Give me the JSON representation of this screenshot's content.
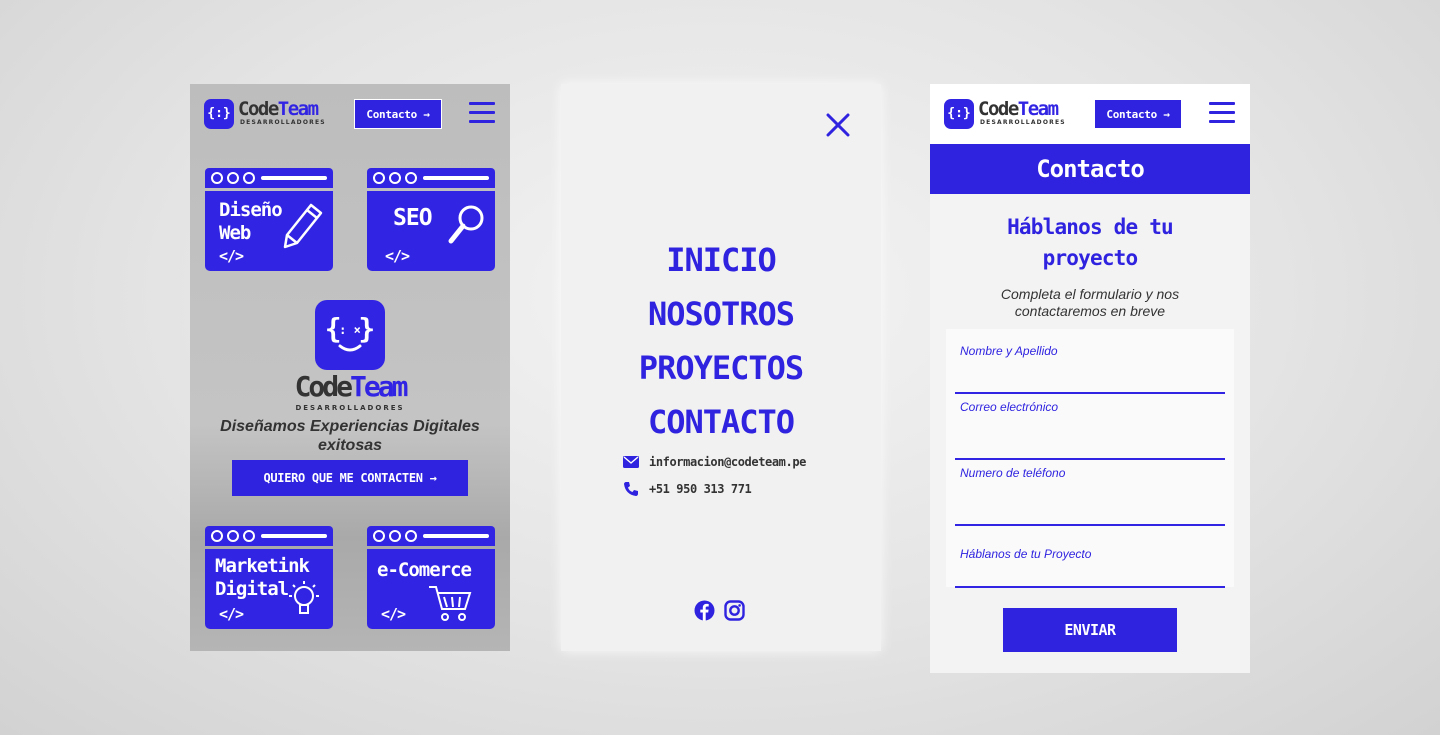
{
  "brand": {
    "word_a": "Code",
    "word_b": "Team",
    "subtitle": "DESARROLLADORES",
    "badge": "{:}",
    "color": "#2f23e0"
  },
  "header": {
    "contact_button": "Contacto →"
  },
  "home": {
    "services": [
      {
        "title_line1": "Diseño",
        "title_line2": "Web",
        "code": "</>",
        "icon": "pencil-icon"
      },
      {
        "title_line1": "SEO",
        "title_line2": "",
        "code": "</>",
        "icon": "magnifier-icon"
      },
      {
        "title_line1": "Marketink",
        "title_line2": "Digital",
        "code": "</>",
        "icon": "lightbulb-icon"
      },
      {
        "title_line1": "e-Comerce",
        "title_line2": "",
        "code": "</>",
        "icon": "shopping-cart-icon"
      }
    ],
    "tagline": "Diseñamos Experiencias Digitales exitosas",
    "cta": "QUIERO QUE ME CONTACTEN →"
  },
  "menu": {
    "items": [
      "INICIO",
      "NOSOTROS",
      "PROYECTOS",
      "CONTACTO"
    ],
    "email": "informacion@codeteam.pe",
    "phone": "+51 950 313 771",
    "socials": [
      "facebook-icon",
      "instagram-icon"
    ]
  },
  "contact": {
    "band_title": "Contacto",
    "heading_line1": "Háblanos de tu",
    "heading_line2": "proyecto",
    "intro": "Completa el formulario y nos contactaremos en breve",
    "fields": [
      "Nombre y Apellido",
      "Correo electrónico",
      "Numero de teléfono",
      "Háblanos de tu Proyecto"
    ],
    "submit": "ENVIAR"
  }
}
